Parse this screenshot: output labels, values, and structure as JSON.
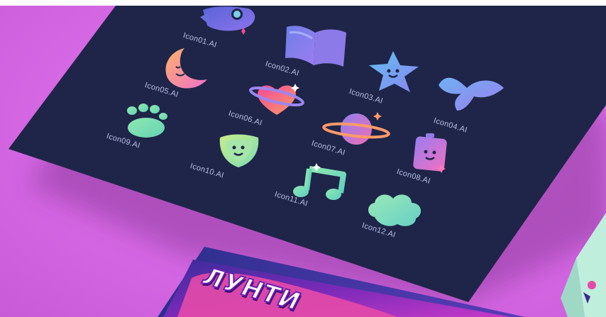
{
  "icons": [
    {
      "name": "rocket-icon",
      "label": "Icon01.AI"
    },
    {
      "name": "book-icon",
      "label": "Icon02.AI"
    },
    {
      "name": "star-face-icon",
      "label": "Icon03.AI"
    },
    {
      "name": "bow-icon",
      "label": "Icon04.AI"
    },
    {
      "name": "moon-face-icon",
      "label": "Icon05.AI"
    },
    {
      "name": "heart-planet-icon",
      "label": "Icon06.AI"
    },
    {
      "name": "planet-icon",
      "label": "Icon07.AI"
    },
    {
      "name": "battery-face-icon",
      "label": "Icon08.AI"
    },
    {
      "name": "paw-icon",
      "label": "Icon09.AI"
    },
    {
      "name": "shield-face-icon",
      "label": "Icon10.AI"
    },
    {
      "name": "music-note-icon",
      "label": "Icon11.AI"
    },
    {
      "name": "cloud-icon",
      "label": "Icon12.AI"
    }
  ],
  "package": {
    "brand_text": "ЛУНТИ"
  },
  "colors": {
    "background": "#de72ee",
    "board": "#1e2548",
    "label": "#b7bfe6",
    "accent_pink": "#f3489a",
    "accent_purple": "#7a68e6",
    "accent_mint": "#86e3b5"
  }
}
